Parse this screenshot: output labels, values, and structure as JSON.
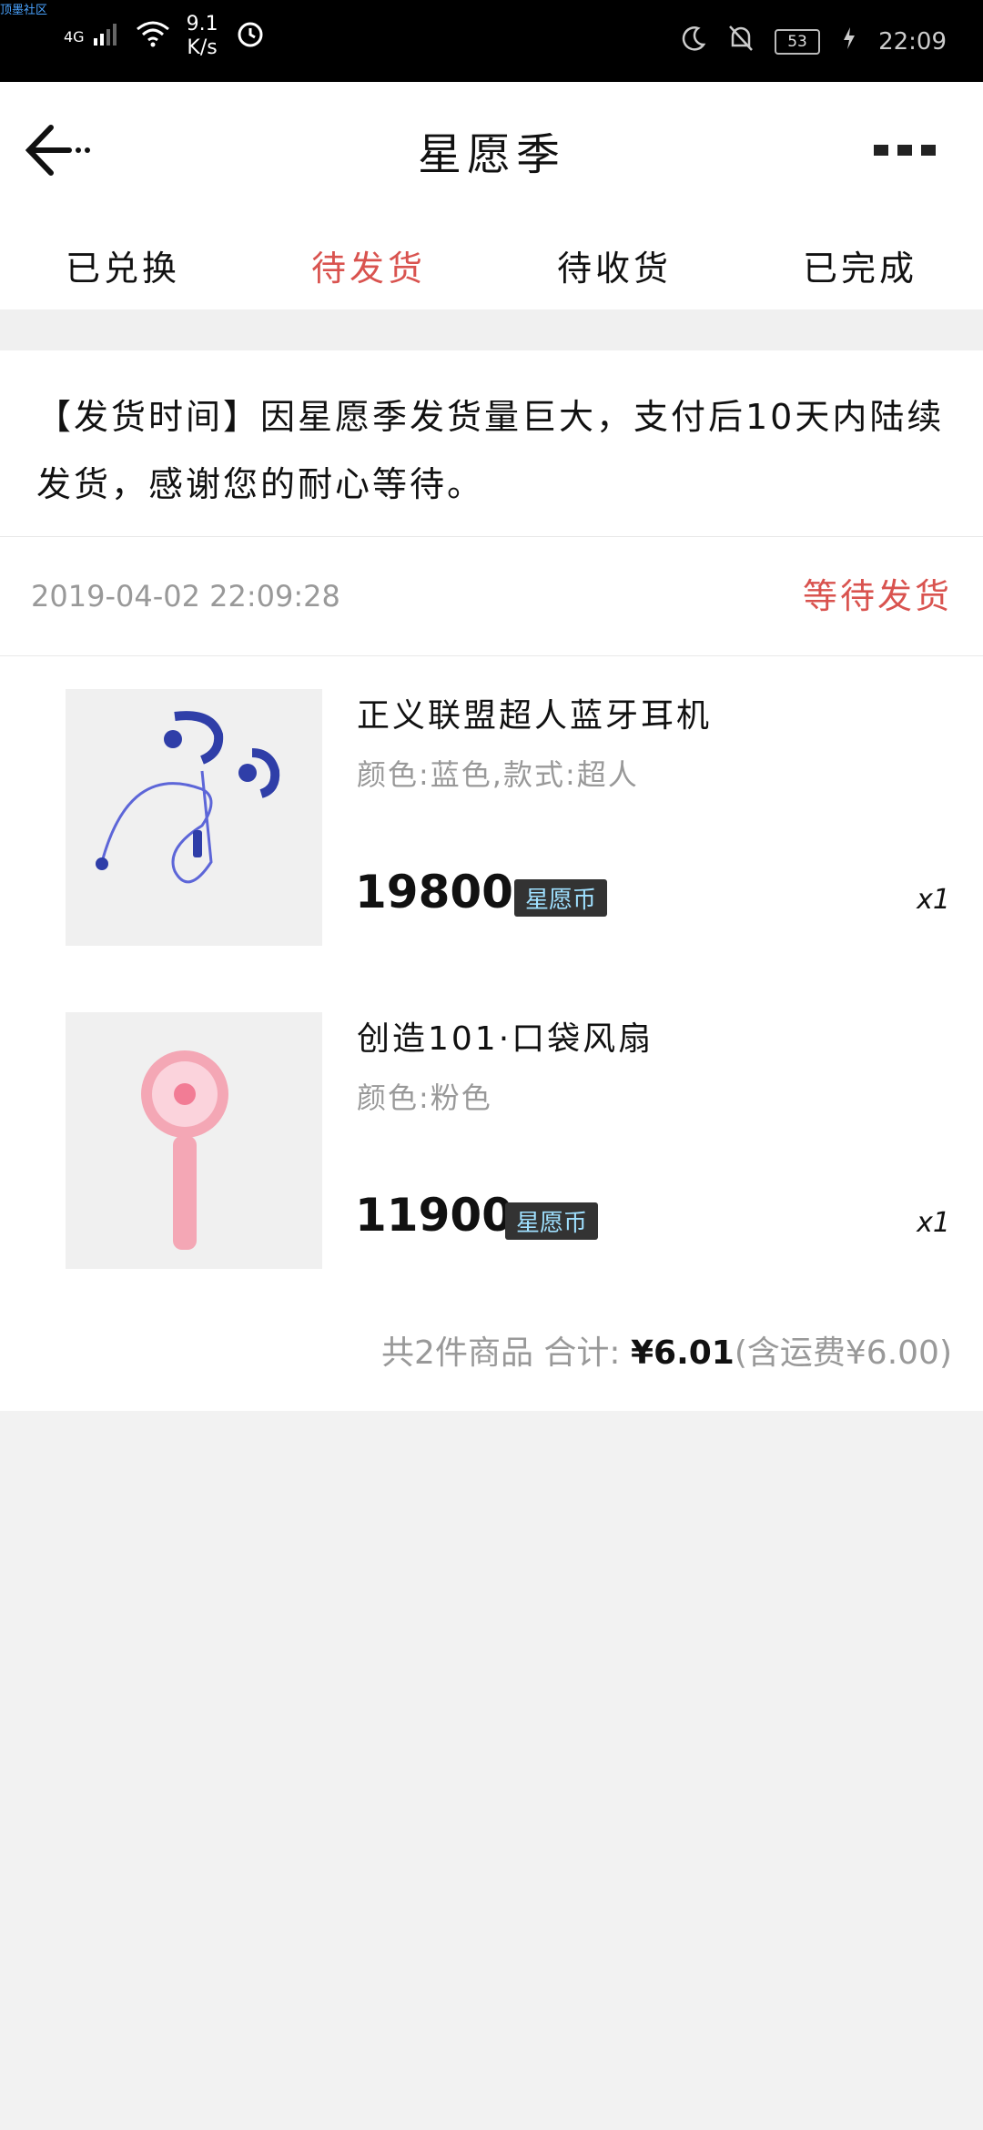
{
  "status_bar": {
    "watermark": "顶墨社区",
    "network": "4G",
    "speed": "9.1\nK/s",
    "battery": "53",
    "time": "22:09"
  },
  "header": {
    "title": "星愿季"
  },
  "tabs": [
    {
      "label": "已兑换"
    },
    {
      "label": "待发货"
    },
    {
      "label": "待收货"
    },
    {
      "label": "已完成"
    }
  ],
  "order": {
    "notice": "【发货时间】因星愿季发货量巨大，支付后10天内陆续发货，感谢您的耐心等待。",
    "date": "2019-04-02  22:09:28",
    "status": "等待发货",
    "items": [
      {
        "name": "正义联盟超人蓝牙耳机",
        "spec": "颜色:蓝色,款式:超人",
        "price": "19800",
        "coin_label": "星愿币",
        "qty": "x1"
      },
      {
        "name": "创造101·口袋风扇",
        "spec": "颜色:粉色",
        "price": "11900",
        "coin_label": "星愿币",
        "qty": "x1"
      }
    ],
    "summary_prefix": "共2件商品  合计: ",
    "summary_total": "¥6.01",
    "summary_suffix": "(含运费¥6.00)"
  },
  "colors": {
    "accent": "#d9534f",
    "muted": "#999999"
  }
}
